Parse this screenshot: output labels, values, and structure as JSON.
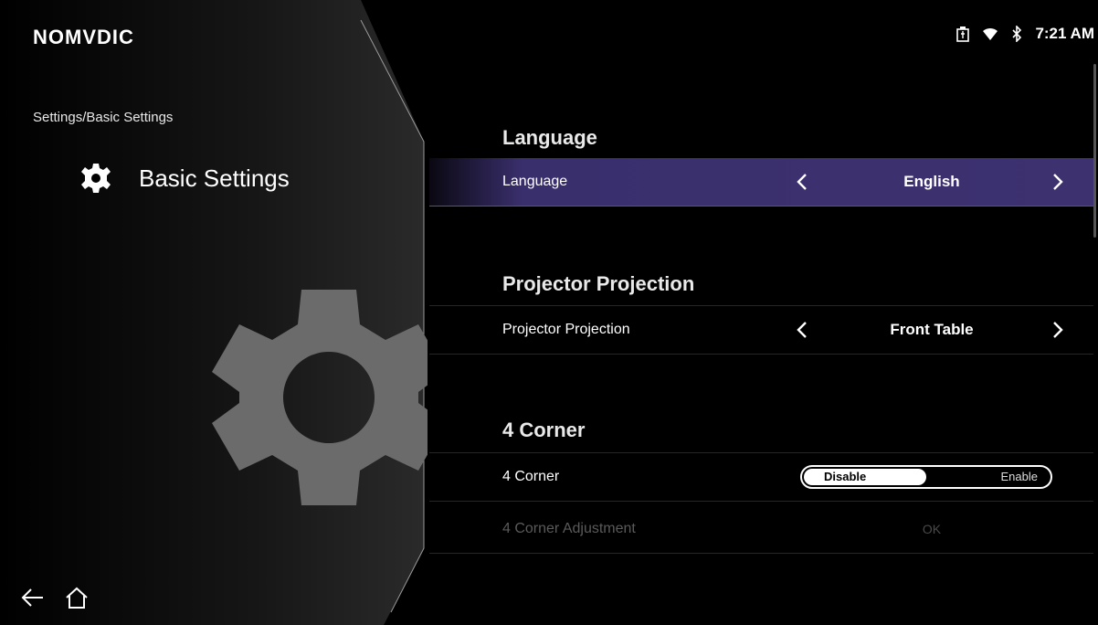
{
  "brand": {
    "logo_text": "NOMVDIC"
  },
  "status": {
    "time": "7:21 AM",
    "icons": [
      "usb-storage-icon",
      "wifi-icon",
      "bluetooth-icon"
    ]
  },
  "sidebar": {
    "breadcrumb": "Settings/Basic Settings",
    "section_title": "Basic Settings",
    "section_icon": "gear-icon",
    "nav": {
      "back_icon": "back-arrow-icon",
      "home_icon": "home-icon"
    }
  },
  "settings": {
    "language": {
      "group_title": "Language",
      "label": "Language",
      "value": "English",
      "selected": true
    },
    "projection": {
      "group_title": "Projector Projection",
      "label": "Projector Projection",
      "value": "Front Table"
    },
    "corner": {
      "group_title": "4 Corner",
      "label": "4 Corner",
      "toggle_off": "Disable",
      "toggle_on": "Enable",
      "state": "Disable"
    },
    "corner_adjust": {
      "label": "4 Corner Adjustment",
      "value": "OK",
      "disabled": true
    }
  },
  "colors": {
    "selected_row": "#3d3170",
    "background": "#000000",
    "left_panel": "#1e1e1e",
    "big_gear": "#6b6b6b"
  }
}
